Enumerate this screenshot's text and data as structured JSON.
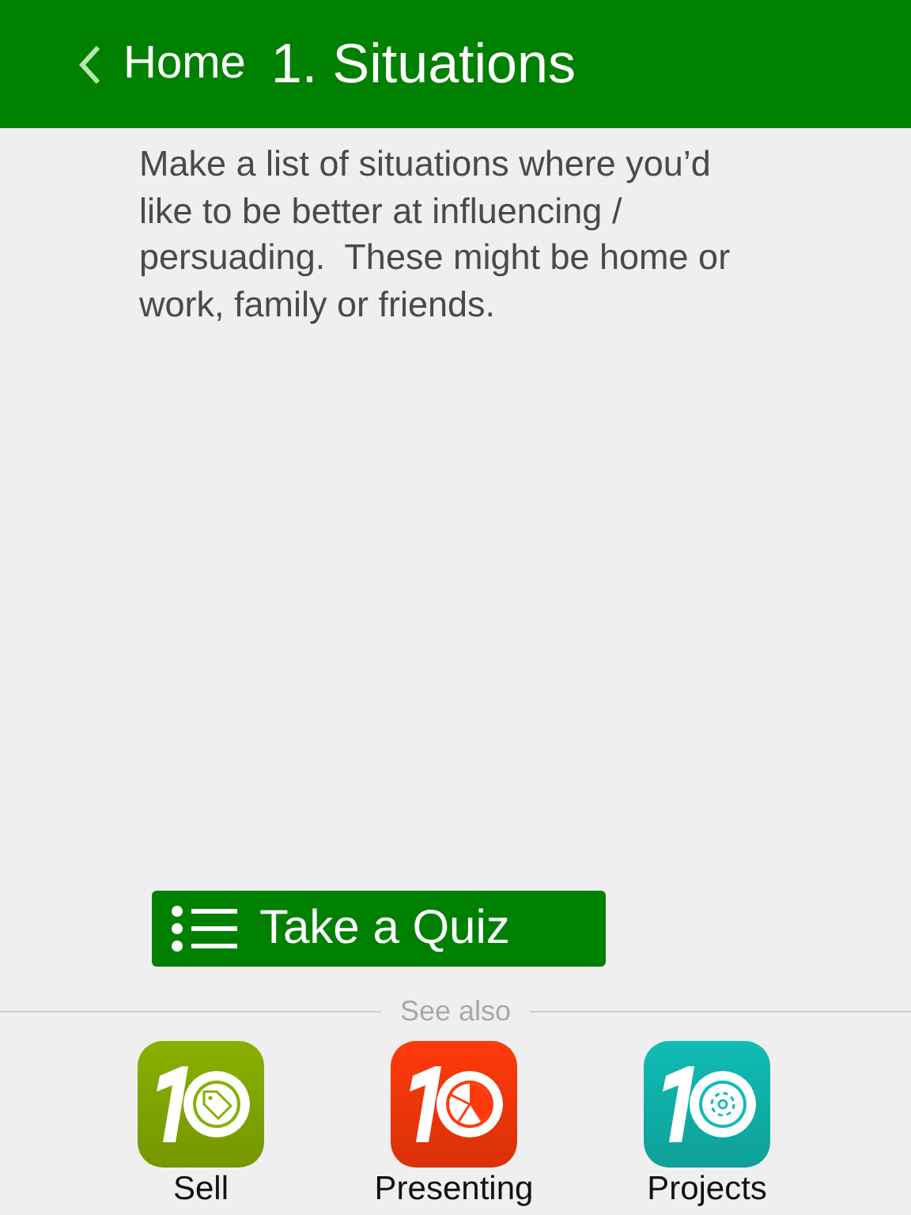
{
  "nav": {
    "back_label": "Home",
    "title": "1. Situations"
  },
  "instructions": "Make a list of situations where you’d like to be better at influencing / persuading.  These might be home or work, family or friends.",
  "quiz_button": {
    "label": "Take a Quiz"
  },
  "see_also": {
    "heading": "See also",
    "apps": [
      {
        "label": "Sell",
        "kind": "tag",
        "color": "#8ab000"
      },
      {
        "label": "Presenting",
        "kind": "pie",
        "color": "#ff3a0a"
      },
      {
        "label": "Projects",
        "kind": "gear",
        "color": "#10bcb4"
      }
    ]
  }
}
